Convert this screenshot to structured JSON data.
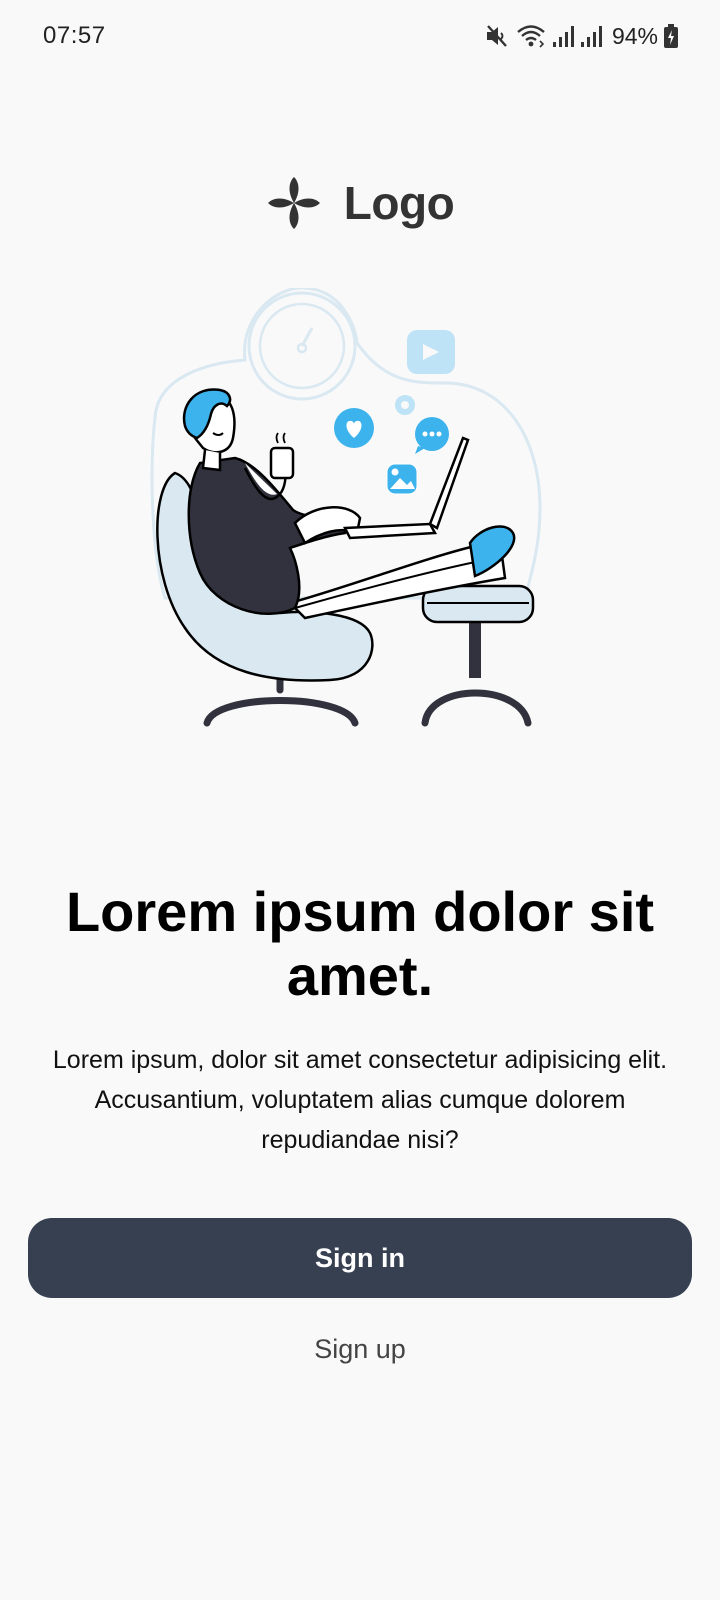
{
  "status_bar": {
    "time": "07:57",
    "battery_percent": "94%",
    "icons": [
      "mute-icon",
      "wifi-icon",
      "signal-icon",
      "signal-icon",
      "battery-charging-icon"
    ]
  },
  "logo": {
    "text": "Logo",
    "icon": "clover-icon"
  },
  "illustration": {
    "subject": "person-relaxing-with-laptop",
    "colors": {
      "accent": "#3cb3ec",
      "light": "#d9e8f1",
      "dark": "#31323d"
    }
  },
  "content": {
    "headline": "Lorem ipsum dolor sit amet.",
    "body": "Lorem ipsum, dolor sit amet consectetur adipisicing elit. Accusantium, voluptatem alias cumque dolorem repudiandae nisi?"
  },
  "actions": {
    "sign_in_label": "Sign in",
    "sign_up_label": "Sign up"
  },
  "colors": {
    "background": "#f9f9f9",
    "primary_button": "#374051"
  }
}
